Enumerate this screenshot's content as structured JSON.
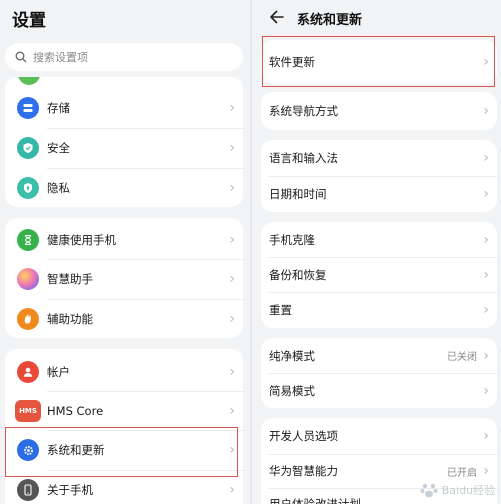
{
  "left": {
    "title": "设置",
    "search_placeholder": "搜索设置项",
    "group1": [
      {
        "label": "存储",
        "icon": "storage-icon",
        "color": "#2f6fe8"
      },
      {
        "label": "安全",
        "icon": "shield-icon",
        "color": "#36b8a6"
      },
      {
        "label": "隐私",
        "icon": "privacy-icon",
        "color": "#3bbfa8"
      }
    ],
    "group2": [
      {
        "label": "健康使用手机",
        "icon": "hourglass-icon",
        "color": "#35b34a"
      },
      {
        "label": "智慧助手",
        "icon": "assistant-icon",
        "color": "#8a6be8"
      },
      {
        "label": "辅助功能",
        "icon": "hand-icon",
        "color": "#f08a1c"
      }
    ],
    "group3": [
      {
        "label": "帐户",
        "icon": "account-icon",
        "color": "#e84a3a"
      },
      {
        "label": "HMS Core",
        "icon": "hms-icon",
        "color": "#e5553f",
        "badge": "HMS"
      },
      {
        "label": "系统和更新",
        "icon": "gear-icon",
        "color": "#2b6de6"
      },
      {
        "label": "关于手机",
        "icon": "phone-icon",
        "color": "#555"
      }
    ]
  },
  "right": {
    "title": "系统和更新",
    "card1": [
      "软件更新"
    ],
    "card2": [
      "系统导航方式"
    ],
    "card3": [
      "语言和输入法",
      "日期和时间"
    ],
    "card4": [
      "手机克隆",
      "备份和恢复",
      "重置"
    ],
    "card5": [
      {
        "label": "纯净模式",
        "value": "已关闭"
      },
      {
        "label": "简易模式",
        "value": ""
      }
    ],
    "card6": [
      {
        "label": "开发人员选项",
        "value": ""
      },
      {
        "label": "华为智慧能力",
        "value": "已开启"
      },
      {
        "label": "用户体验改进计划",
        "value": ""
      }
    ]
  },
  "watermark": "Baidu经验",
  "colors": {
    "highlight": "#d9534f",
    "background": "#f1f3f5"
  }
}
